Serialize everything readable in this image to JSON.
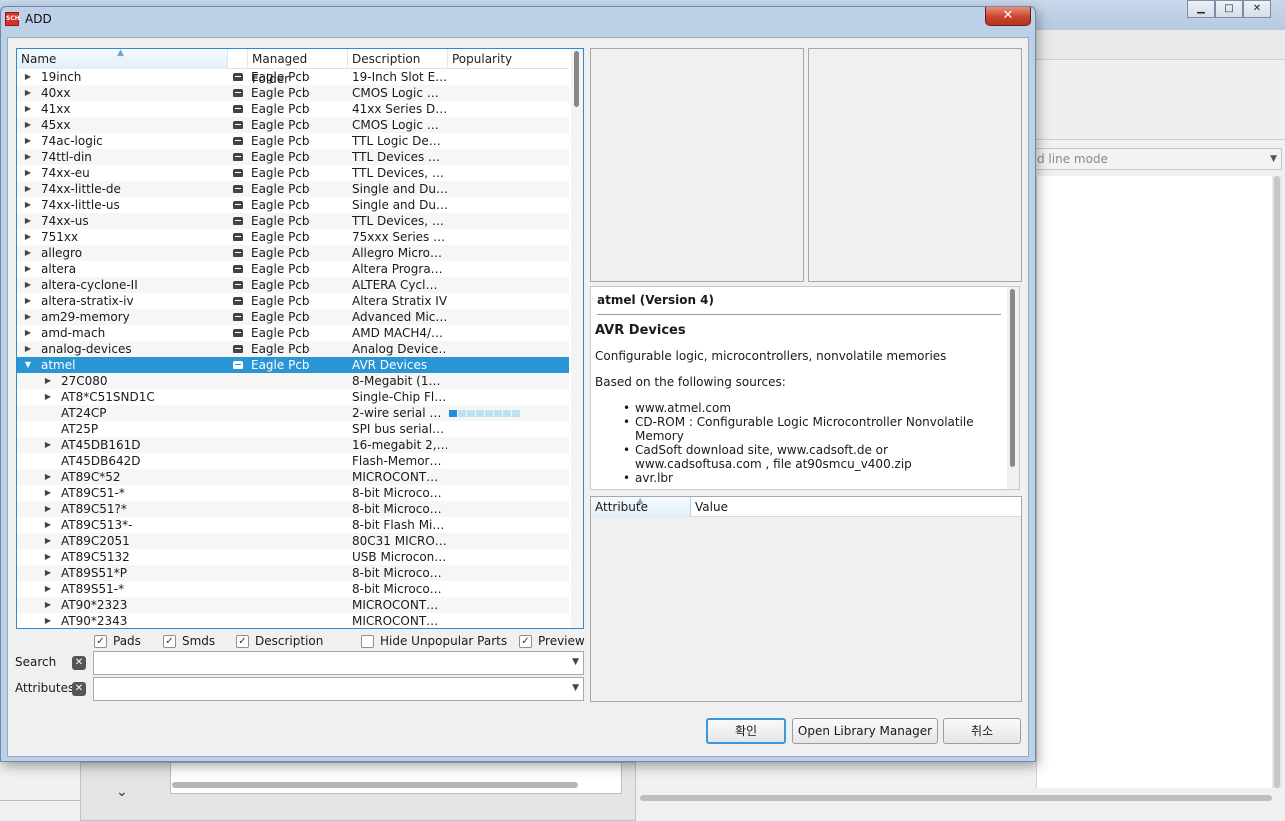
{
  "background": {
    "mode_combo_text": "d line mode",
    "window_buttons": [
      "▁",
      "□",
      "✕"
    ],
    "expand_glyph": "⌄"
  },
  "dialog": {
    "title": "ADD",
    "app_icon_text": "SCH",
    "close_glyph": "✕"
  },
  "tree": {
    "columns": [
      "Name",
      "Managed Folder",
      "Description",
      "Popularity"
    ],
    "sorted_column": "Name",
    "rows": [
      {
        "level": 0,
        "expander": "▶",
        "name": "19inch",
        "managed": "Eagle Pcb",
        "desc": "19-Inch Slot E…",
        "selected": false
      },
      {
        "level": 0,
        "expander": "▶",
        "name": "40xx",
        "managed": "Eagle Pcb",
        "desc": "CMOS Logic …",
        "selected": false
      },
      {
        "level": 0,
        "expander": "▶",
        "name": "41xx",
        "managed": "Eagle Pcb",
        "desc": "41xx Series D…",
        "selected": false
      },
      {
        "level": 0,
        "expander": "▶",
        "name": "45xx",
        "managed": "Eagle Pcb",
        "desc": "CMOS Logic …",
        "selected": false
      },
      {
        "level": 0,
        "expander": "▶",
        "name": "74ac-logic",
        "managed": "Eagle Pcb",
        "desc": "TTL Logic De…",
        "selected": false
      },
      {
        "level": 0,
        "expander": "▶",
        "name": "74ttl-din",
        "managed": "Eagle Pcb",
        "desc": "TTL Devices …",
        "selected": false
      },
      {
        "level": 0,
        "expander": "▶",
        "name": "74xx-eu",
        "managed": "Eagle Pcb",
        "desc": "TTL Devices, …",
        "selected": false
      },
      {
        "level": 0,
        "expander": "▶",
        "name": "74xx-little-de",
        "managed": "Eagle Pcb",
        "desc": "Single and Du…",
        "selected": false
      },
      {
        "level": 0,
        "expander": "▶",
        "name": "74xx-little-us",
        "managed": "Eagle Pcb",
        "desc": "Single and Du…",
        "selected": false
      },
      {
        "level": 0,
        "expander": "▶",
        "name": "74xx-us",
        "managed": "Eagle Pcb",
        "desc": "TTL Devices, …",
        "selected": false
      },
      {
        "level": 0,
        "expander": "▶",
        "name": "751xx",
        "managed": "Eagle Pcb",
        "desc": "75xxx Series …",
        "selected": false
      },
      {
        "level": 0,
        "expander": "▶",
        "name": "allegro",
        "managed": "Eagle Pcb",
        "desc": "Allegro Micro…",
        "selected": false
      },
      {
        "level": 0,
        "expander": "▶",
        "name": "altera",
        "managed": "Eagle Pcb",
        "desc": "Altera Progra…",
        "selected": false
      },
      {
        "level": 0,
        "expander": "▶",
        "name": "altera-cyclone-II",
        "managed": "Eagle Pcb",
        "desc": "ALTERA Cycl…",
        "selected": false
      },
      {
        "level": 0,
        "expander": "▶",
        "name": "altera-stratix-iv",
        "managed": "Eagle Pcb",
        "desc": "Altera Stratix IV",
        "selected": false
      },
      {
        "level": 0,
        "expander": "▶",
        "name": "am29-memory",
        "managed": "Eagle Pcb",
        "desc": "Advanced Mic…",
        "selected": false
      },
      {
        "level": 0,
        "expander": "▶",
        "name": "amd-mach",
        "managed": "Eagle Pcb",
        "desc": "AMD MACH4/…",
        "selected": false
      },
      {
        "level": 0,
        "expander": "▶",
        "name": "analog-devices",
        "managed": "Eagle Pcb",
        "desc": "Analog Device…",
        "selected": false
      },
      {
        "level": 0,
        "expander": "▼",
        "name": "atmel",
        "managed": "Eagle Pcb",
        "desc": "AVR Devices",
        "selected": true
      },
      {
        "level": 1,
        "expander": "▶",
        "name": "27C080",
        "managed": "",
        "desc": "8-Megabit (1…",
        "selected": false
      },
      {
        "level": 1,
        "expander": "▶",
        "name": "AT8*C51SND1C",
        "managed": "",
        "desc": "Single-Chip Fl…",
        "selected": false
      },
      {
        "level": 1,
        "expander": "",
        "name": "AT24CP",
        "managed": "",
        "desc": "2-wire serial …",
        "selected": false,
        "popularity": 0.125
      },
      {
        "level": 1,
        "expander": "",
        "name": "AT25P",
        "managed": "",
        "desc": "SPI bus serial…",
        "selected": false
      },
      {
        "level": 1,
        "expander": "▶",
        "name": "AT45DB161D",
        "managed": "",
        "desc": "16-megabit 2,…",
        "selected": false
      },
      {
        "level": 1,
        "expander": "",
        "name": "AT45DB642D",
        "managed": "",
        "desc": "Flash-Memor…",
        "selected": false
      },
      {
        "level": 1,
        "expander": "▶",
        "name": "AT89C*52",
        "managed": "",
        "desc": "MICROCONT…",
        "selected": false
      },
      {
        "level": 1,
        "expander": "▶",
        "name": "AT89C51-*",
        "managed": "",
        "desc": "8-bit Microco…",
        "selected": false
      },
      {
        "level": 1,
        "expander": "▶",
        "name": "AT89C51?*",
        "managed": "",
        "desc": "8-bit Microco…",
        "selected": false
      },
      {
        "level": 1,
        "expander": "▶",
        "name": "AT89C513*-",
        "managed": "",
        "desc": "8-bit Flash Mi…",
        "selected": false
      },
      {
        "level": 1,
        "expander": "▶",
        "name": "AT89C2051",
        "managed": "",
        "desc": "80C31 MICRO…",
        "selected": false
      },
      {
        "level": 1,
        "expander": "▶",
        "name": "AT89C5132",
        "managed": "",
        "desc": "USB Microcon…",
        "selected": false
      },
      {
        "level": 1,
        "expander": "▶",
        "name": "AT89S51*P",
        "managed": "",
        "desc": "8-bit Microco…",
        "selected": false
      },
      {
        "level": 1,
        "expander": "▶",
        "name": "AT89S51-*",
        "managed": "",
        "desc": "8-bit Microco…",
        "selected": false
      },
      {
        "level": 1,
        "expander": "▶",
        "name": "AT90*2323",
        "managed": "",
        "desc": "MICROCONT…",
        "selected": false
      },
      {
        "level": 1,
        "expander": "▶",
        "name": "AT90*2343",
        "managed": "",
        "desc": "MICROCONT…",
        "selected": false
      }
    ]
  },
  "filters": {
    "pads": {
      "label": "Pads",
      "checked": true
    },
    "smds": {
      "label": "Smds",
      "checked": true
    },
    "description": {
      "label": "Description",
      "checked": true
    },
    "hide_unpopular": {
      "label": "Hide Unpopular Parts",
      "checked": false
    },
    "preview": {
      "label": "Preview",
      "checked": true
    },
    "check_glyph": "✓"
  },
  "search": {
    "label": "Search",
    "value": "",
    "clear_glyph": "✕",
    "arrow": "▼"
  },
  "attributes_filter": {
    "label": "Attributes",
    "value": "",
    "clear_glyph": "✕",
    "arrow": "▼"
  },
  "info": {
    "title": "atmel (Version 4)",
    "heading": "AVR Devices",
    "paragraph1": "Configurable logic, microcontrollers, nonvolatile memories",
    "paragraph2": "Based on the following sources:",
    "sources": [
      "www.atmel.com",
      "CD-ROM : Configurable Logic Microcontroller Nonvolatile Memory",
      "CadSoft download site, www.cadsoft.de or www.cadsoftusa.com , file at90smcu_v400.zip",
      "avr.lbr"
    ]
  },
  "attr_table": {
    "columns": [
      "Attribute",
      "Value"
    ]
  },
  "buttons": {
    "ok": "확인",
    "open_library_manager": "Open Library Manager",
    "cancel": "취소"
  },
  "colors": {
    "selection": "#2a95d5",
    "popularity_on": "#1f8fd6",
    "popularity_off": "#bfe1f6",
    "close_button": "#c7442e"
  }
}
